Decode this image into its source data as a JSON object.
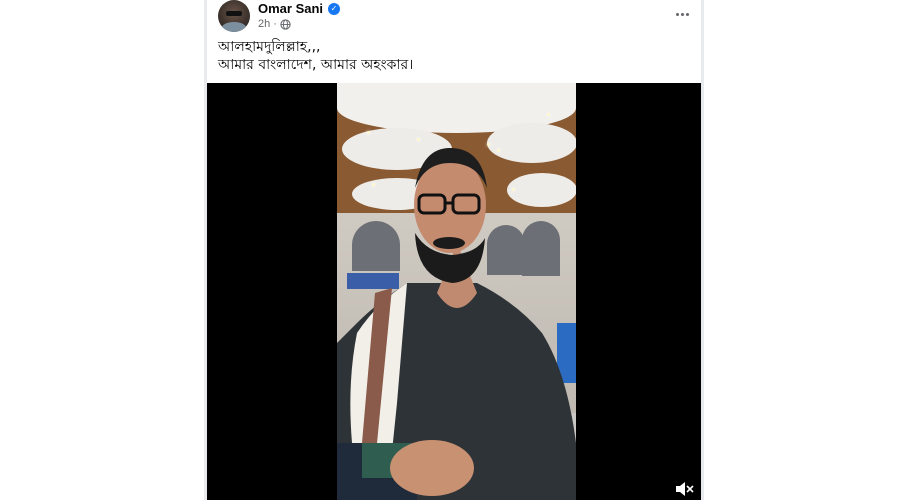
{
  "post": {
    "author": {
      "name": "Omar Sani",
      "verified": true,
      "avatar_icon": "profile-photo"
    },
    "meta": {
      "time": "2h",
      "separator": "·",
      "audience_icon": "globe-icon"
    },
    "more_icon": "more-options-icon",
    "caption": {
      "line1": "আলহামদুলিল্লাহ,,,",
      "line2": "আমার বাংলাদেশ, আমার অহংকার।"
    },
    "video": {
      "sound_icon": "speaker-muted-icon"
    }
  },
  "colors": {
    "verified": "#1877f2",
    "meta_text": "#65676b",
    "text": "#050505",
    "video_bg": "#000000"
  }
}
